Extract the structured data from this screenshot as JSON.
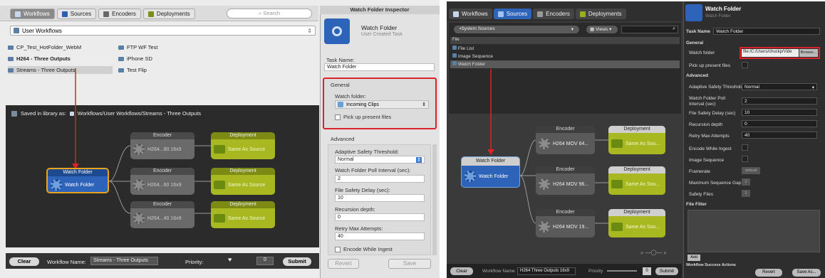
{
  "left": {
    "tabs": [
      {
        "label": "Workflows",
        "selected": true
      },
      {
        "label": "Sources"
      },
      {
        "label": "Encoders"
      },
      {
        "label": "Deployments"
      }
    ],
    "search_placeholder": "Search",
    "dropdown": "User Workflows",
    "workflows_col1": [
      "CP_Test_HotFolder_WebM",
      "H264 - Three Outputs",
      "Streams - Three Outputs"
    ],
    "workflows_col2": [
      "FTP WF Test",
      "iPhone SD",
      "Test Flip"
    ],
    "saved_label": "Saved in library as:",
    "saved_path": "Workflows/User Workflows/Streams - Three Outputs",
    "source_node": {
      "header": "Watch Folder",
      "label": "Watch Folder"
    },
    "encoders": [
      {
        "header": "Encoder",
        "label": "H264...80 16x9"
      },
      {
        "header": "Encoder",
        "label": "H264...60 16x9"
      },
      {
        "header": "Encoder",
        "label": "H264...40 16x9"
      }
    ],
    "deployments": [
      {
        "header": "Deployment",
        "label": "Same As Source"
      },
      {
        "header": "Deployment",
        "label": "Same As Source"
      },
      {
        "header": "Deployment",
        "label": "Same As Source"
      }
    ],
    "bottom": {
      "clear": "Clear",
      "wf_name_label": "Workflow Name:",
      "wf_name": "Streams - Three Outputs",
      "priority_label": "Priority:",
      "priority": "0",
      "submit": "Submit"
    },
    "inspector": {
      "title": "Watch Folder Inspector",
      "name": "Watch Folder",
      "subtitle": "User Created Task",
      "task_name_label": "Task Name:",
      "task_name": "Watch Folder",
      "general": "General",
      "watch_folder_label": "Watch folder:",
      "watch_folder": "Incoming Clips",
      "pickup": "Pick up present files",
      "advanced": "Advanced",
      "adaptive_label": "Adaptive Safety Threshold:",
      "adaptive": "Normal",
      "poll_label": "Watch Folder Poll Interval (sec):",
      "poll": "2",
      "delay_label": "File Safety Delay (sec):",
      "delay": "10",
      "recursion_label": "Recursion depth:",
      "recursion": "0",
      "retry_label": "Retry Max Attempts:",
      "retry": "40",
      "encode_while": "Encode While Ingest",
      "revert": "Revert",
      "save": "Save"
    }
  },
  "right": {
    "tabs": [
      {
        "label": "Workflows"
      },
      {
        "label": "Sources",
        "selected": true
      },
      {
        "label": "Encoders"
      },
      {
        "label": "Deployments"
      }
    ],
    "dropdown": "System Sources",
    "views": "Views",
    "list_header": "File",
    "list": [
      "File List",
      "Image Sequence",
      "Watch Folder"
    ],
    "source_node": {
      "header": "Watch Folder",
      "label": "Watch Folder"
    },
    "encoders": [
      {
        "header": "Encoder",
        "label": "H264 MOV 64..."
      },
      {
        "header": "Encoder",
        "label": "H264 MOV 96..."
      },
      {
        "header": "Encoder",
        "label": "H264 MOV 19..."
      }
    ],
    "deployments": [
      {
        "header": "Deployment",
        "label": "Same As Sou..."
      },
      {
        "header": "Deployment",
        "label": "Same As Sou..."
      },
      {
        "header": "Deployment",
        "label": "Same As Sou..."
      }
    ],
    "bottom": {
      "clear": "Clear",
      "wf_name_label": "Workflow Name",
      "wf_name": "H264 Three Outputs 16x9",
      "priority_label": "Priority",
      "priority": "0",
      "submit": "Submit"
    },
    "inspector": {
      "title": "Watch Folder",
      "subtitle": "Watch Folder",
      "task_name_label": "Task Name",
      "task_name": "Watch Folder",
      "general": "General",
      "watch_folder_label": "Watch folder",
      "watch_folder": "file:/C:/Users/chuckp/Vide",
      "browse": "Browse...",
      "pickup": "Pick up present files",
      "advanced": "Advanced",
      "adaptive_label": "Adaptive Safety Threshold",
      "adaptive": "Normal",
      "poll_label": "Watch Folder Poll Interval (sec)",
      "poll": "2",
      "delay_label": "File Safety Delay (sec)",
      "delay": "10",
      "recursion_label": "Recursion depth",
      "recursion": "0",
      "retry_label": "Retry Max Attempts",
      "retry": "40",
      "encode_while": "Encode While Ingest",
      "image_seq": "Image Sequence",
      "framerate_label": "Framerate",
      "framerate": "default",
      "max_gap_label": "Maximum Sequence Gap",
      "max_gap": "1",
      "safety_files_label": "Safety Files",
      "safety_files": "1",
      "file_filter": "File Filter",
      "add": "Add",
      "actions": "Workflow Success Actions",
      "revert": "Revert",
      "save": "Save As..."
    }
  },
  "colors": {
    "highlight": "#d9232a",
    "source_blue": "#2d63b8",
    "deploy_green": "#a8b820"
  }
}
